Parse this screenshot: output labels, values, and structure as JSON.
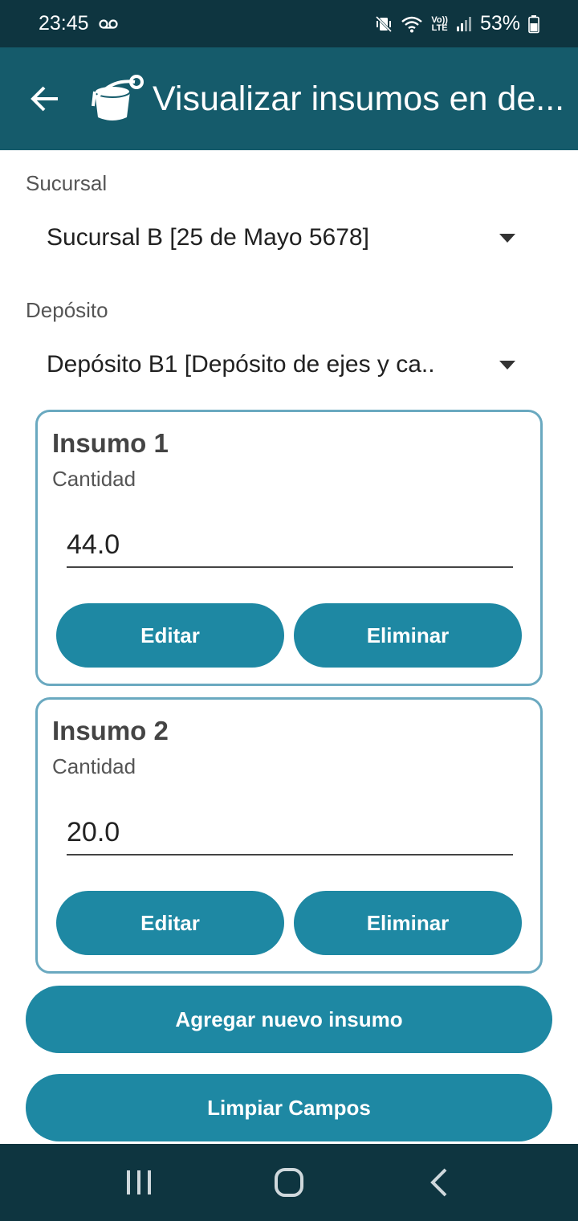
{
  "status_bar": {
    "time": "23:45",
    "voicemail_icon": "voicemail-icon",
    "mute_icon": "vibrate-mute-icon",
    "wifi_icon": "wifi-icon",
    "volte_top": "Vo))",
    "volte_bottom": "LTE",
    "signal_icon": "signal-icon",
    "battery": "53%",
    "battery_icon": "battery-icon"
  },
  "app_bar": {
    "title": "Visualizar insumos en de...",
    "back_icon": "arrow-back-icon",
    "app_icon": "paint-bucket-icon",
    "color": "#155b6b"
  },
  "sucursal": {
    "label": "Sucursal",
    "value": "Sucursal B [25 de Mayo 5678]"
  },
  "deposito": {
    "label": "Depósito",
    "value": "Depósito B1 [Depósito de ejes y ca.."
  },
  "insumos": [
    {
      "title": "Insumo 1",
      "quantity_label": "Cantidad",
      "quantity": "44.0",
      "edit_label": "Editar",
      "delete_label": "Eliminar"
    },
    {
      "title": "Insumo 2",
      "quantity_label": "Cantidad",
      "quantity": "20.0",
      "edit_label": "Editar",
      "delete_label": "Eliminar"
    }
  ],
  "actions": {
    "add_label": "Agregar nuevo insumo",
    "clear_label": "Limpiar Campos"
  },
  "nav_bar": {
    "recents_icon": "recents-icon",
    "home_icon": "home-icon",
    "back_icon": "nav-back-icon"
  },
  "colors": {
    "accent": "#1e88a3",
    "card_border": "#6aa9c0",
    "status_bar": "#0e3540"
  }
}
